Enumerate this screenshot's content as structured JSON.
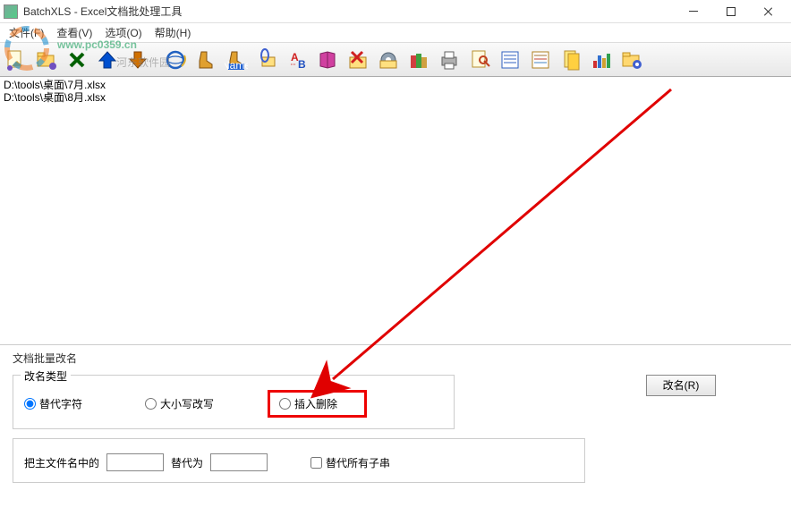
{
  "window": {
    "title": "BatchXLS - Excel文档批处理工具"
  },
  "menu": {
    "file": "文件(F)",
    "view": "查看(V)",
    "option": "选项(O)",
    "help": "帮助(H)"
  },
  "files": {
    "line1": "D:\\tools\\桌面\\7月.xlsx",
    "line2": "D:\\tools\\桌面\\8月.xlsx"
  },
  "panel": {
    "title": "文档批量改名",
    "group_rename_type": "改名类型",
    "opt_replace": "替代字符",
    "opt_case": "大小写改写",
    "opt_insert": "插入删除",
    "btn_rename": "改名(R)",
    "label_main_prefix": "把主文件名中的",
    "label_replace_as": "替代为",
    "chk_all_sub": "替代所有子串",
    "input1_value": "",
    "input2_value": ""
  },
  "watermark": {
    "url": "www.pc0359.cn",
    "brand": "河东软件园"
  }
}
